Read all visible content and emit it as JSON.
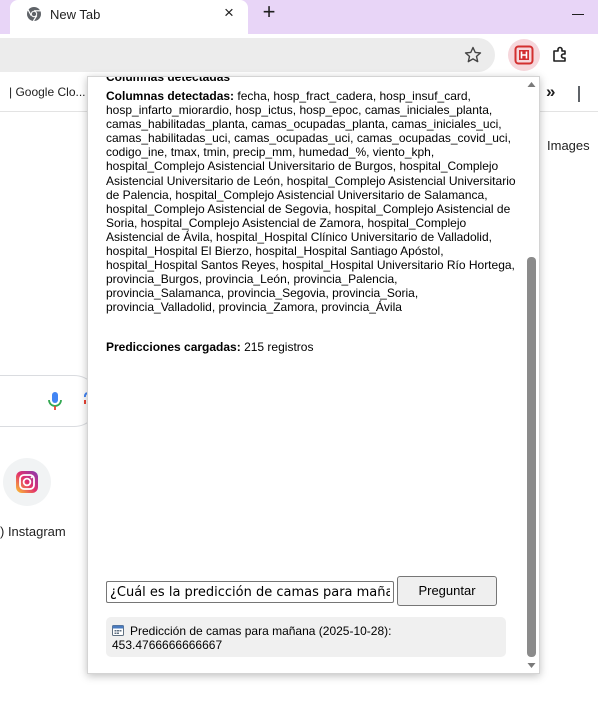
{
  "tab": {
    "title": "New Tab",
    "close": "×",
    "new_tab": "+"
  },
  "bookmarks": {
    "google_cloud": "| Google Clo...",
    "overflow": "»"
  },
  "ntp": {
    "images": "Images",
    "shortcut_label": ") Instagram"
  },
  "popup": {
    "cut_text": "Columnas detectadas",
    "columns_label": "Columnas detectadas:",
    "columns_value": "fecha, hosp_fract_cadera, hosp_insuf_card, hosp_infarto_miorardio, hosp_ictus, hosp_epoc, camas_iniciales_planta, camas_habilitadas_planta, camas_ocupadas_planta, camas_iniciales_uci, camas_habilitadas_uci, camas_ocupadas_uci, camas_ocupadas_covid_uci, codigo_ine, tmax, tmin, precip_mm, humedad_%, viento_kph, hospital_Complejo Asistencial Universitario de Burgos, hospital_Complejo Asistencial Universitario de León, hospital_Complejo Asistencial Universitario de Palencia, hospital_Complejo Asistencial Universitario de Salamanca, hospital_Complejo Asistencial de Segovia, hospital_Complejo Asistencial de Soria, hospital_Complejo Asistencial de Zamora, hospital_Complejo Asistencial de Ávila, hospital_Hospital Clínico Universitario de Valladolid, hospital_Hospital El Bierzo, hospital_Hospital Santiago Apóstol, hospital_Hospital Santos Reyes, hospital_Hospital Universitario Río Hortega, provincia_Burgos, provincia_León, provincia_Palencia, provincia_Salamanca, provincia_Segovia, provincia_Soria, provincia_Valladolid, provincia_Zamora, provincia_Ávila",
    "predictions_label": "Predicciones cargadas:",
    "predictions_value": "215 registros",
    "question_value": "¿Cuál es la predicción de camas para mañana?",
    "ask_button": "Preguntar",
    "answer_text": "Predicción de camas para mañana (2025-10-28): 453.4766666666667"
  },
  "colors": {
    "tab_strip": "#e8d5f7",
    "extension_accent": "#d32f2f"
  }
}
